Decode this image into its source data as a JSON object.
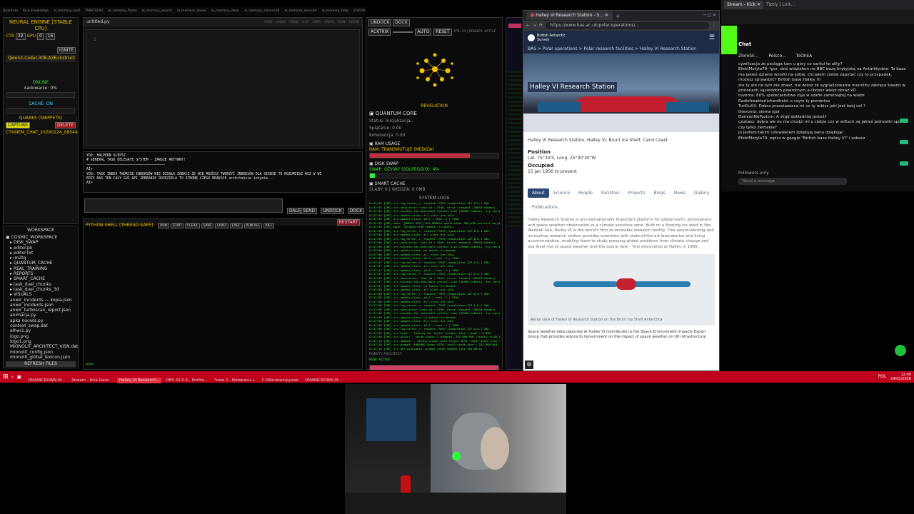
{
  "topbar": {
    "items": [
      "Quantum",
      "Kick_knowledge",
      "ai_memory_load",
      "TABSTACKS",
      "ai_memory_flame",
      "ai_memory_search",
      "ai_memory_abuse",
      "ai_memory_ideas",
      "ai_memory_advanced",
      "ai_memory_execute",
      "ai_memory_help",
      "STATUS",
      "ai_memory_stream"
    ]
  },
  "left_panel": {
    "title": "NEURAL ENGINE [STABLE CPU]",
    "ctx_label": "CTX",
    "ctx_value": "32",
    "gpu_label": "GPU",
    "gpu_value": "0",
    "threads_value": "16",
    "ignite_label": "IGNITE",
    "model": "Qwen3-Coder-30B-A3B-Instruct-UD-Q8_K",
    "online": "ONLINE",
    "loading": "Ładowanie: 0%",
    "cache_on": "CACHE: ON",
    "quarks_title": "QUARKS (SNIPPETS)",
    "capture_label": "CAPTURE",
    "delete_label": "DELETE",
    "quark_item": "CTXMEM_CHAT_20260224_085449_3549",
    "workspace_title": "WORKSPACE",
    "workspace_root": "COSMIC_WORKSPACE",
    "workspace_items": [
      "DISK_SWAP",
      "editor.pk",
      "editor.txt",
      "im2tg",
      "QUANTUM_CACHE",
      "REAL_TRAINING",
      "REPORTS",
      "SMART_CACHE",
      "task_duel_chunks",
      "task_duel_chunks_3d",
      "VISUALS",
      "anwir_incidents — kopia.json",
      "anwir_incidents.json",
      "anwir_turboscan_report.json",
      "animacja.py",
      "apka nocess.py",
      "context_swap.dat",
      "ether1.py",
      "logo.png",
      "logo1.png",
      "MIONOLIT_ARCHITECT_VISN.dat",
      "mionolit_config.json",
      "mionolit_global_lexicon.json"
    ],
    "refresh_label": "REFRESH FILES"
  },
  "editor": {
    "file_tab": "untitled.py",
    "line_number": "1",
    "toolbar_items": [
      "SAVE",
      "UNDO",
      "REDO",
      "CUT",
      "COPY",
      "PASTE",
      "RUN",
      "CLEAR"
    ]
  },
  "console": {
    "lines": [
      "YOU: HALPERN ULEPSZ",
      "                    # GENERAL TASK DELEGATE SYSTEM - ZAWSZE AKTYWNY!",
      "                    ──────────────────────────────────────",
      "AI>",
      "YOU: TASK INDEX TWÓRCIE INDEKSÓW NIE DZIAŁA ZOBACZ ŻE NIE MOŻESZ TWORZYĆ INDEKSÓW DLA SIEBIE TO ROZUMIESZ WSZ W WI",
      "EDZY NAS TEN CAŁY GUI API ZEBRANIE ROZDZIELA TO STRONĘ CZEGO BRAKUJE architekcie inżynie...",
      "AI>"
    ],
    "send_label": "DALEJ SEND",
    "undock_label": "UNDOCK",
    "dock_label": "DOCK"
  },
  "python_shell": {
    "title": "PYTHON SHELL [THREAD-SAFE]",
    "buttons": [
      "RUN",
      "STOP",
      "CLEAR",
      "SAVE",
      "LOAD",
      "EXEC",
      "RUN ALL",
      "KILL"
    ],
    "restart_label": "RESTART",
    "prompt": ">>>"
  },
  "right_panel": {
    "undock_label": "UNDOCK",
    "dock_label": "DOCK",
    "acktrix_label": "ACKTRIX",
    "auto_label": "AUTO",
    "reset_label": "RESET",
    "stats": "FPS: 37 | RENDER: ACTIVE",
    "revelation_label": "REVELATION",
    "quantum_core": "QUANTUM CORE",
    "status": "Status: Inicjalizacja...",
    "splatanie": "Splątanie: 0.00",
    "koherencja": "Koherencja: 0.00",
    "ram_title": "RAM USAGE",
    "ram_status": "RAM: TRANSMUTUJE (MEDIZA)",
    "ram_fill": 0.78,
    "disk_title": "DISK SWAP",
    "disk_status": "SWAP: OŻYWY (SOLFEGGIO): 4%",
    "disk_fill": 0.04,
    "smart_cache_title": "SMART CACHE",
    "smart_cache_status": "SLABY: 0 | WIEDZA: 0.0MB",
    "system_logs_title": "SYSTEM LOGS",
    "footer_label": "ROBOTY ARCHITECT",
    "footer_status": "NEW: ACTIVE"
  },
  "log_lines": [
    "12:47:05 [INF] srv  log_server_r: request: POST /completion 127.0.0.1 200",
    "12:47:05 [INF] srv      send_error: task id = 3546, error: request (30010 tokens)",
    "12:47:05 [INF] srv  exceeds the available context size (20480 tokens), try increasing it",
    "12:47:05 [INF] srv   update_slots: all slots are idle",
    "12:47:05 [INF] srv   update_slots: id  0 | task -1 | 3546",
    "12:47:05 [INF] main: [MODEL ARTY] DLA MODELU qwen3-coder-30b-a3b-instruct-ud_q8_k",
    "12:47:05 [INF] main: (prompt 3546 tokens, 3 tokens)",
    "12:47:06 [INF] srv  log_server_r: request: POST /completion 127.0.0.1 200",
    "12:47:06 [INF] srv   update_slots: all slots are idle",
    "12:47:06 [INF] srv  log_server_r: request: POST /completion 127.0.0.1 400",
    "12:47:06 [INF] srv      send_error: task id = 3548, error: request (30010 tokens)",
    "12:47:06 [INF] srv  exceeds the available context size (20480 tokens), try increasing it",
    "12:47:06 [INF] srv   update_slots: no tokens to decode",
    "12:47:06 [INF] srv   update_slots: all slots are idle",
    "12:47:06 [INF] srv   update_slots: id  0 | task -1 | 3548",
    "12:47:07 [INF] srv  log_server_r: request: POST /completion 127.0.0.1 200",
    "12:47:07 [INF] srv   update_slots: all slots are idle",
    "12:47:07 [INF] srv   update_slots: id  0 | task -1 | 3550",
    "12:47:07 [INF] srv  log_server_r: request: POST /completion 127.0.0.1 400",
    "12:47:07 [INF] srv      send_error: task id = 3552, error: request (30010 tokens)",
    "12:47:07 [INF] srv  exceeds the available context size (20480 tokens), try increasing it",
    "12:47:07 [INF] srv   update_slots: no tokens to decode",
    "12:47:08 [INF] srv   update_slots: all slots are idle",
    "12:47:08 [INF] srv  log_server_r: request: POST /completion 127.0.0.1 200",
    "12:47:08 [INF] srv   update_slots: id  0 | task -1 | 3554",
    "12:47:08 [INF] srv   update_slots: all slots are idle",
    "12:47:08 [INF] srv  log_server_r: request: POST /completion 127.0.0.1 400",
    "12:47:08 [INF] srv      send_error: task id = 3556, error: request (30010 tokens)",
    "12:47:08 [INF] srv  exceeds the available context size (20480 tokens), try increasing it",
    "12:47:09 [INF] srv   update_slots: no tokens to decode",
    "12:47:09 [INF] srv   update_slots: all slots are idle",
    "12:47:09 [INF] srv   update_slots: id  0 | task -1 | 3558",
    "12:47:09 [INF] srv  log_server_r: request: POST /completion 127.0.0.1 200",
    "12:47:09 [INF] srv    load: - looking for better prompt, base f_keep = 0.008",
    "12:47:09 [INF] srv    alloc: - cache state: 3 prompts, 335.988 MiB (limits: 8192.000 MiB, 20480 tokens)",
    "12:47:10 [INF] srv   update: - saving prompt with length 4876, total state size = 181.888 MiB",
    "12:47:10 [INF] srv   prompt: 4980000 token 4976, total state size = 181.888 MiB",
    "12:47:10 [INF] srv  get_available: prompt cache update took 283.00 ms"
  ],
  "browser": {
    "tab_title": "Halley VI Research Station - S...",
    "url": "https://www.bas.ac.uk/polar-operations/...",
    "org_name": "British Antarctic Survey",
    "breadcrumb": "BAS > Polar operations > Polar research facilities > Halley VI Research Station",
    "hero_title": "Halley VI Research Station",
    "names": "Halley VI Research Station, Halley VI, Brunt Ice Shelf, Caird Coast",
    "position_label": "Position",
    "position_value": "Lat. 75°34'S, Long. 25°30'30\"W",
    "occupied_label": "Occupied",
    "occupied_value": "15 Jan 1956 to present",
    "nav_tabs": [
      "About",
      "Science",
      "People",
      "Facilities",
      "Projects",
      "Blogs",
      "News",
      "Gallery",
      "Publications"
    ],
    "body_text": "Halley Research Station is an internationally important platform for global earth, atmospheric and space weather observation in a climate sensitive zone. Built on a floating ice shelf in the Weddell Sea, Halley VI is the world's first re-locatable research facility. This award-winning and innovative research station provides scientists with state-of-the-art laboratories and living accommodation, enabling them to study pressing global problems from climate change and sea level rise to space weather and the ozone hole – first discovered at Halley in 1985.",
    "image_caption": "Aerial view of Halley VI Research Station on the Brunt Ice Shelf Antarctica",
    "bottom_text": "Space weather data captured at Halley VI contributes to the Space Environment Impacts Expert Group that provides advice to Government on the impact of space weather on UK infrastructure"
  },
  "chat": {
    "tab_title": "Stream - Kick",
    "tab2_title": "Tiptly | Link...",
    "header": "Chat",
    "channels": [
      "ZlomSk...",
      "Polsco...",
      "ToOhkA"
    ],
    "messages": [
      "cywilizacja że pociąga tam u góry co sarkui te ality?",
      "EfektMotyla79: Igor, dziś widziałem na BBC bazę brytyjską na Antarktydzie. Ta baza ma jakieś dziwne wzorki na sobie. chciałem ciebie zapytać czy to przypadek. możesz sprawdzić?  British base Halley VI",
      "ste ty ale na tym nie znasz, nie wiesz ze sygnalizowanie monolitu zakręca kwarki w protonach sąsiedzkim powrotnym a chcesz wiesz obraz xD",
      "tuvoma: 80% społeczeństwa żyje w szafie zamkniętej na wieże",
      "Radiofreakterlichardheld: o czym ty pierdolisz",
      "TurKluXX: Dobra przestawiacz mi co ty robisz jaki jest twój cel ?",
      "thevonto: siema Igor",
      "DamianNoPoziom: A skąd dokładniej jesteś?",
      "czukasz: dobra ale no nie chodzi mi o ciebie czy w wiltach są jakieś jednostki spoza czy tylko ziemskie?",
      "Jo jestem takim człowiekiem dziękuję panu dziękuję!",
      "EfektMotyla79: wpisz w google \"British base Halley VI\" i zobacz"
    ],
    "followers_note": "Followers only",
    "input_placeholder": "Send a message"
  },
  "taskbar": {
    "items": [
      "OMAINCROWN-M...",
      "Stream - Kick Dash...",
      "Halley VI Research...",
      "OBS 32.0.4 - Profile...",
      "*new 2 - Notepad++",
      "C:\\Windows\\py.exe",
      "OMAINCROWN-M..."
    ],
    "language": "POL",
    "time": "12:48",
    "date": "24/02/2026"
  },
  "colors": {
    "accent_gold": "#f0c200",
    "terminal_green": "#38e838",
    "bas_blue": "#2b4a73",
    "taskbar_red": "#c0001a",
    "chat_green": "#53fc18"
  }
}
